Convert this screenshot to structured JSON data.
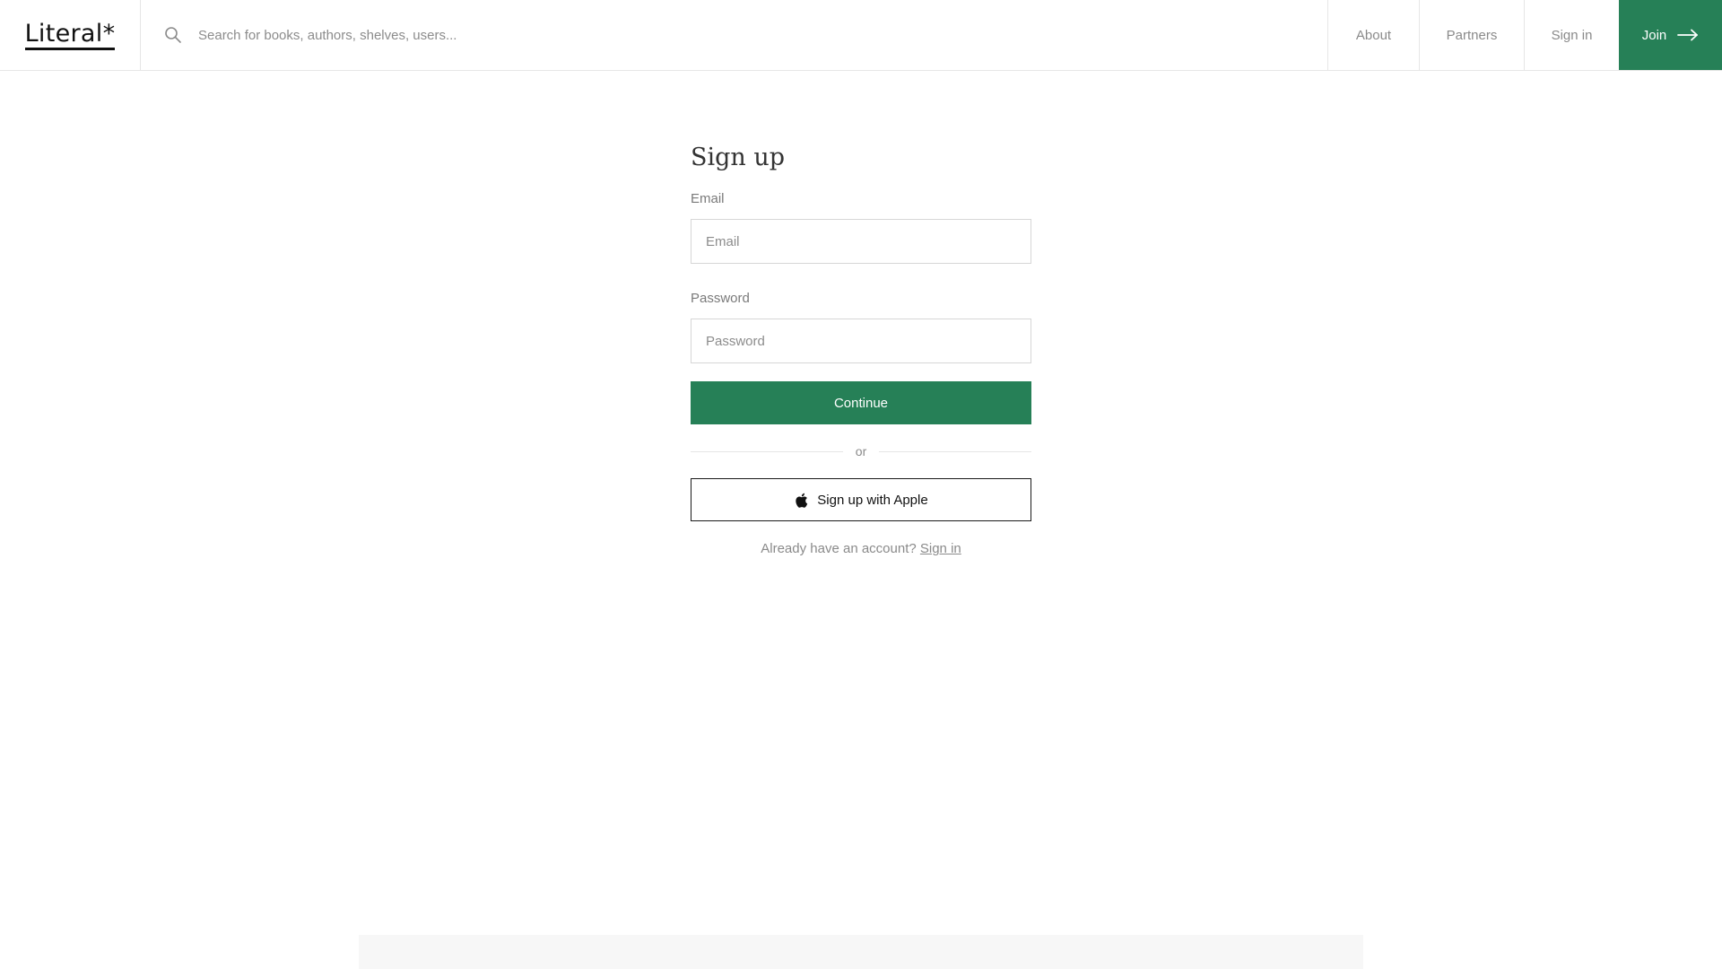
{
  "header": {
    "logo_text": "Literal*",
    "search_placeholder": "Search for books, authors, shelves, users...",
    "nav": {
      "about": "About",
      "partners": "Partners",
      "sign_in": "Sign in",
      "join": "Join"
    },
    "icons": {
      "search": "search-icon",
      "join_arrow": "arrow-right-icon"
    }
  },
  "form": {
    "title": "Sign up",
    "email_label": "Email",
    "email_placeholder": "Email",
    "password_label": "Password",
    "password_placeholder": "Password",
    "continue_label": "Continue",
    "divider_text": "or",
    "apple_label": "Sign up with Apple",
    "apple_icon": "apple-icon",
    "already_text": "Already have an account?",
    "signin_link": "Sign in"
  },
  "colors": {
    "accent": "#268057",
    "border": "#e6e6e6",
    "muted_text": "#8a8a8a"
  }
}
